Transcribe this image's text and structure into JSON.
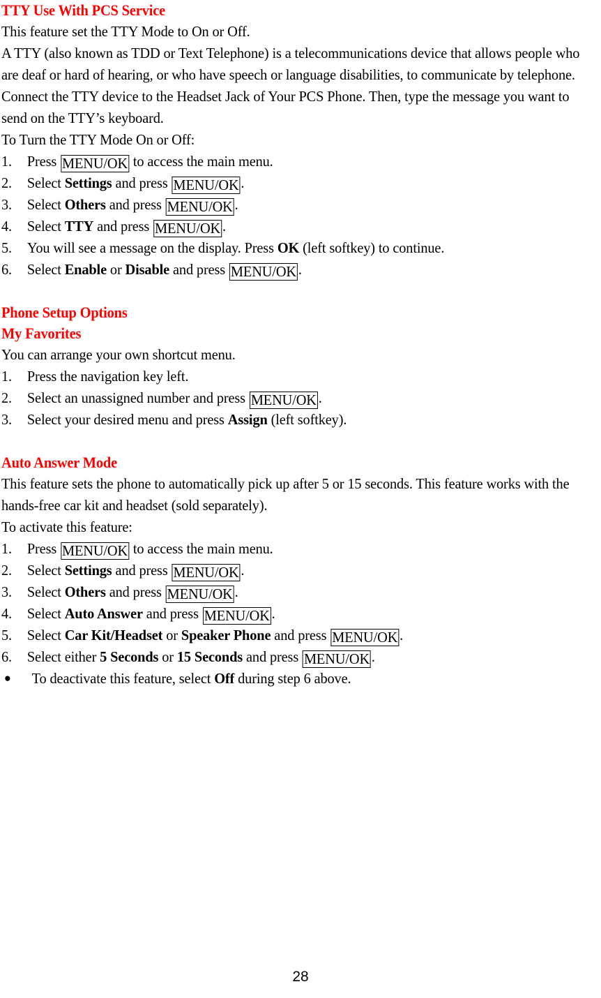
{
  "document": {
    "page_number": "28",
    "heading_color": "#ff0000",
    "text_color": "#000000",
    "background_color": "#ffffff"
  },
  "sections": {
    "tty": {
      "heading": "TTY Use With PCS Service",
      "para1": "This feature set the TTY Mode to On or Off.",
      "para2": "A TTY (also known as TDD or Text Telephone) is a telecommunications device that allows people who are deaf or hard of hearing, or who have speech or language disabilities, to communicate by telephone. Connect the TTY device to the Headset Jack of Your PCS Phone. Then, type the message you want to send on the TTY’s keyboard.",
      "para3": "To Turn the TTY Mode On or Off:",
      "steps": [
        {
          "number": "1.",
          "pre": "Press ",
          "key1": "MENU/OK",
          "mid": " to access the main menu.",
          "bold1": "",
          "post": ""
        },
        {
          "number": "2.",
          "pre": "Select ",
          "bold1": "Settings",
          "mid": " and press ",
          "key1": "MENU/OK",
          "post": "."
        },
        {
          "number": "3.",
          "pre": "Select ",
          "bold1": "Others",
          "mid": " and press ",
          "key1": "MENU/OK",
          "post": "."
        },
        {
          "number": "4.",
          "pre": "Select ",
          "bold1": "TTY",
          "mid": " and press ",
          "key1": "MENU/OK",
          "post": "."
        },
        {
          "number": "5.",
          "pre": "You will see a message on the display. Press ",
          "bold1": "OK",
          "mid": " (left softkey) to continue.",
          "key1": "",
          "post": ""
        },
        {
          "number": "6.",
          "pre": "Select ",
          "bold1": "Enable",
          "mid_a": " or ",
          "bold2": "Disable",
          "mid": " and press ",
          "key1": "MENU/OK",
          "post": "."
        }
      ]
    },
    "phone_setup": {
      "heading": "Phone Setup Options",
      "subheading": "My Favorites",
      "para1": "You can arrange your own shortcut menu.",
      "steps": [
        {
          "number": "1.",
          "pre": "Press the navigation key left.",
          "bold1": "",
          "mid": "",
          "key1": "",
          "post": ""
        },
        {
          "number": "2.",
          "pre": "Select an unassigned number and press ",
          "bold1": "",
          "mid": "",
          "key1": "MENU/OK",
          "post": "."
        },
        {
          "number": "3.",
          "pre": "Select your desired menu and press ",
          "bold1": "Assign",
          "mid": " (left softkey).",
          "key1": "",
          "post": ""
        }
      ]
    },
    "auto_answer": {
      "heading": "Auto Answer Mode",
      "para1": "This feature sets the phone to automatically pick up after 5 or 15 seconds. This feature works with the hands-free car kit and headset (sold separately).",
      "para2": "To activate this feature:",
      "steps": [
        {
          "number": "1.",
          "pre": "Press ",
          "key1": "MENU/OK",
          "mid": " to access the main menu.",
          "bold1": "",
          "post": ""
        },
        {
          "number": "2.",
          "pre": "Select ",
          "bold1": "Settings",
          "mid": " and press ",
          "key1": "MENU/OK",
          "post": "."
        },
        {
          "number": "3.",
          "pre": "Select ",
          "bold1": "Others",
          "mid": " and press ",
          "key1": "MENU/OK",
          "post": "."
        },
        {
          "number": "4.",
          "pre": "Select ",
          "bold1": "Auto Answer",
          "mid": " and press ",
          "key1": "MENU/OK",
          "post": "."
        },
        {
          "number": "5.",
          "pre": "Select ",
          "bold1": "Car Kit/Headset",
          "mid_a": " or ",
          "bold2": "Speaker Phone",
          "mid": " and press ",
          "key1": "MENU/OK",
          "post": "."
        },
        {
          "number": "6.",
          "pre": "Select either ",
          "bold1": "5 Seconds",
          "mid_a": " or ",
          "bold2": "15 Seconds",
          "mid": " and press ",
          "key1": "MENU/OK",
          "post": "."
        }
      ],
      "note": {
        "bullet": "●",
        "pre": "To deactivate this feature, select ",
        "bold1": "Off",
        "post": " during step 6 above."
      }
    }
  }
}
